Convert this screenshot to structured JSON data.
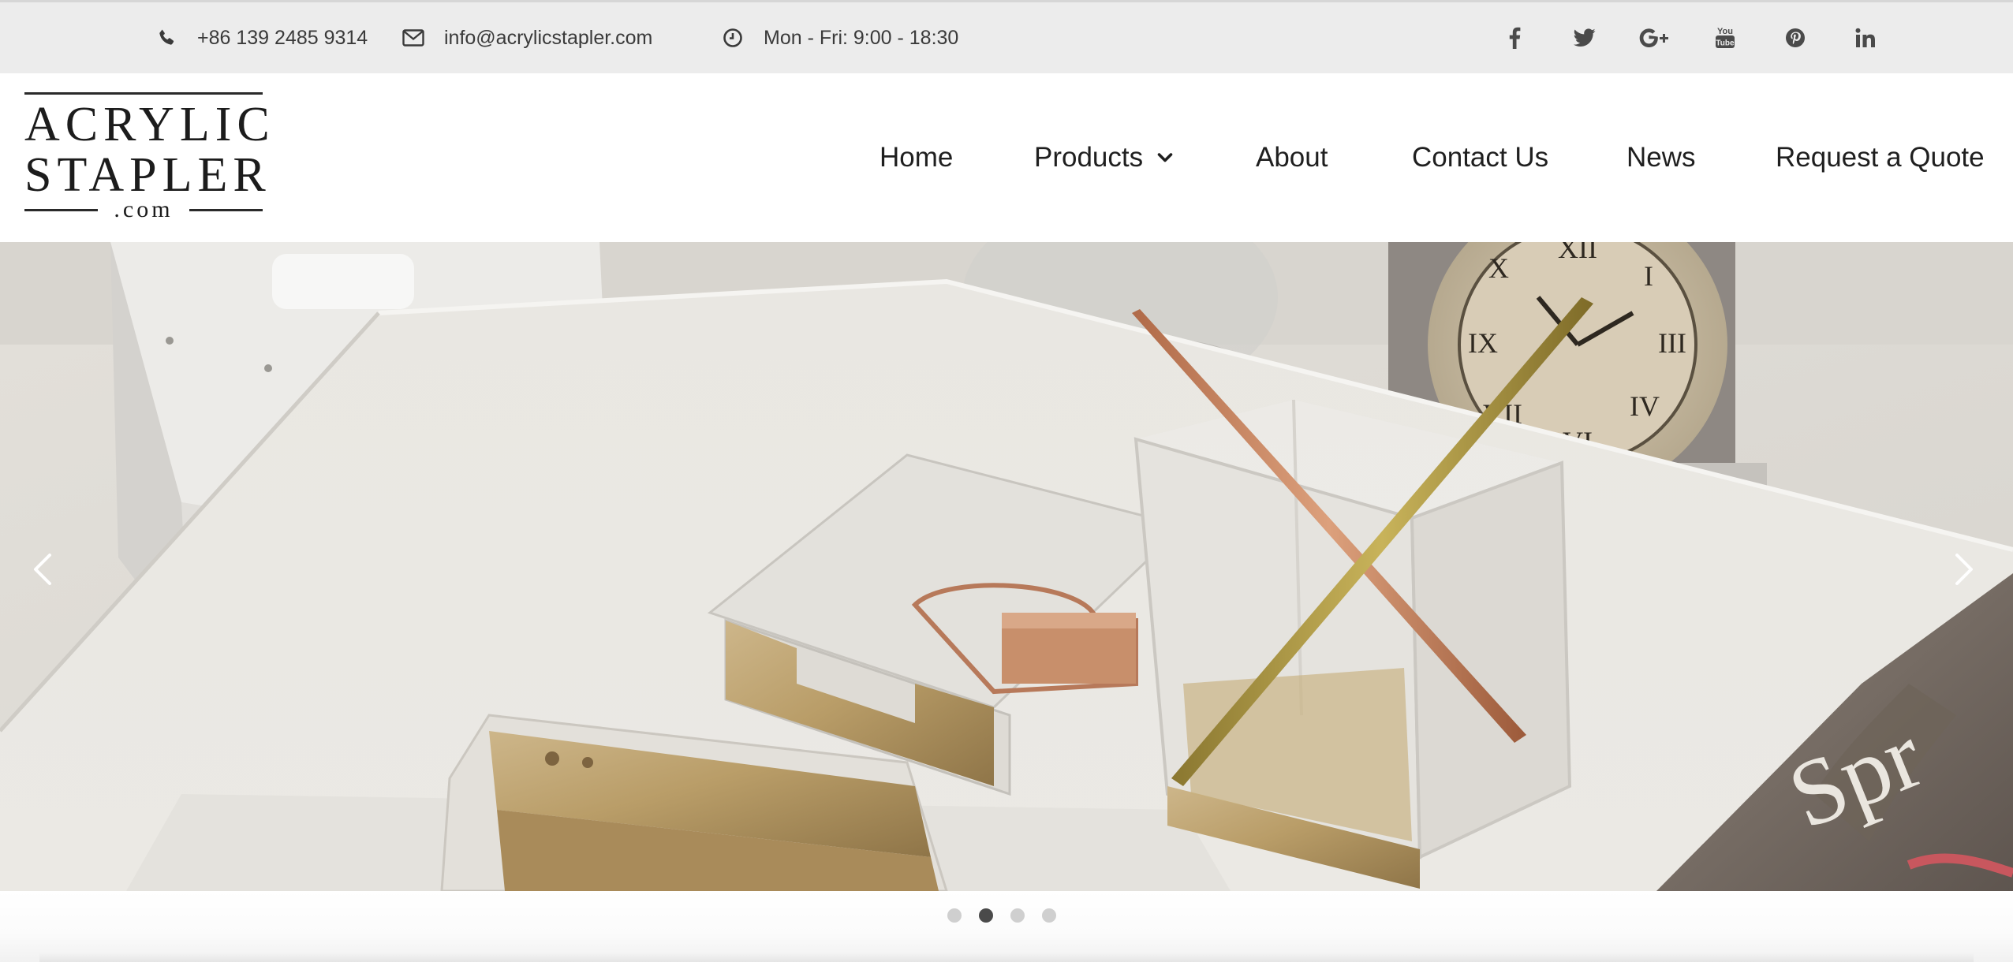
{
  "topbar": {
    "phone": {
      "icon": "phone-icon",
      "text": "+86 139 2485 9314"
    },
    "email": {
      "icon": "envelope-icon",
      "text": "info@acrylicstapler.com"
    },
    "hours": {
      "icon": "clock-icon",
      "text": "Mon - Fri: 9:00 - 18:30"
    },
    "social": [
      {
        "name": "facebook-icon"
      },
      {
        "name": "twitter-icon"
      },
      {
        "name": "google-plus-icon",
        "text": "G+"
      },
      {
        "name": "youtube-icon",
        "text": "You"
      },
      {
        "name": "pinterest-icon"
      },
      {
        "name": "linkedin-icon",
        "text": "in"
      }
    ]
  },
  "logo": {
    "line1": "ACRYLIC",
    "line2": "STAPLER",
    "line3": ".com"
  },
  "nav": {
    "items": [
      {
        "label": "Home"
      },
      {
        "label": "Products",
        "has_dropdown": true,
        "icon": "chevron-down-icon"
      },
      {
        "label": "About"
      },
      {
        "label": "Contact Us"
      },
      {
        "label": "News"
      },
      {
        "label": "Request a Quote"
      }
    ]
  },
  "slider": {
    "prev_icon": "chevron-left-icon",
    "next_icon": "chevron-right-icon",
    "slide_count": 4,
    "active_index": 2,
    "magazine_text": "Spr"
  },
  "colors": {
    "topbar_bg": "#ececec",
    "text_dark": "#1f1f1f",
    "dot_active": "#4a4a4a",
    "dot_inactive": "#cfcfcf"
  }
}
